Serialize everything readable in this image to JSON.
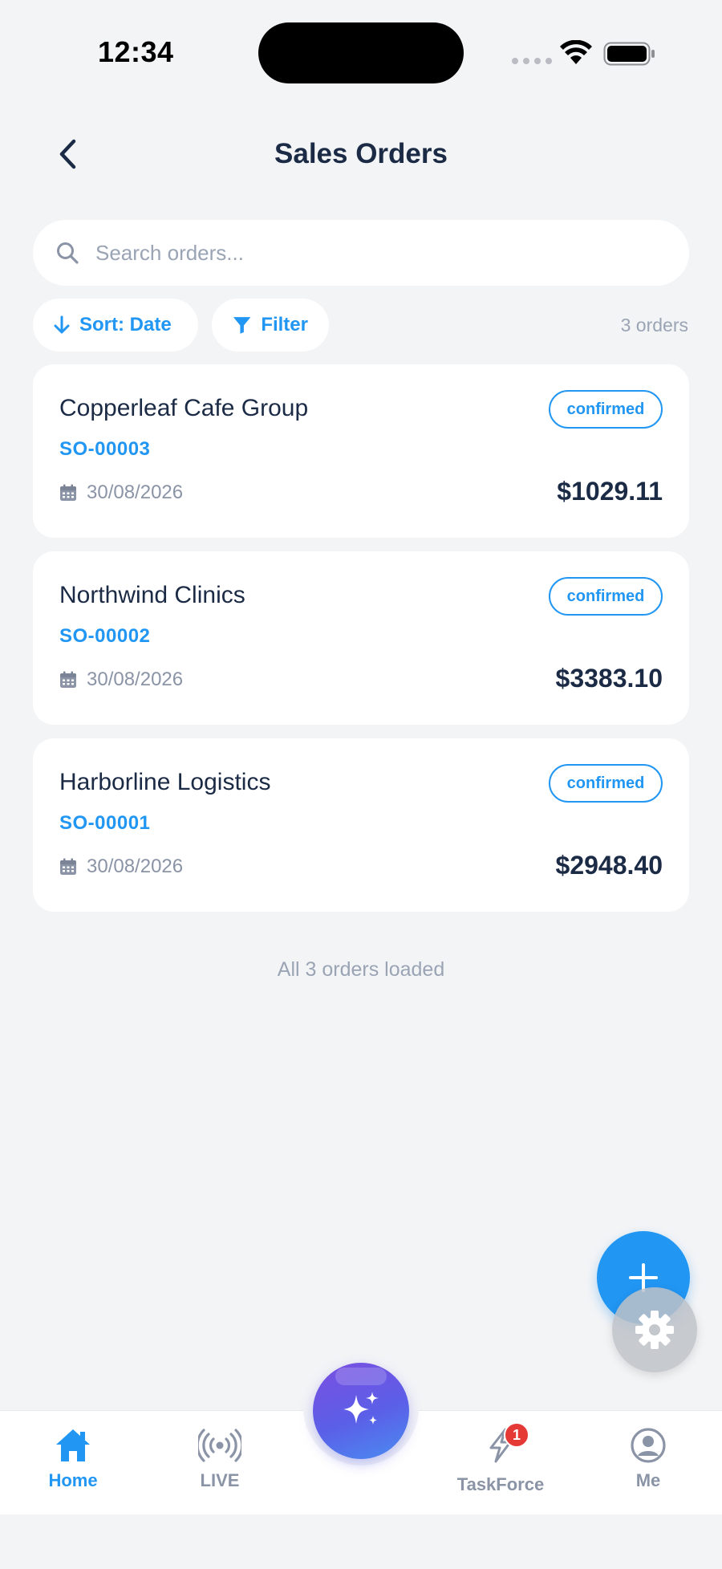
{
  "status_bar": {
    "time": "12:34"
  },
  "header": {
    "title": "Sales Orders"
  },
  "search": {
    "placeholder": "Search orders..."
  },
  "toolbar": {
    "sort_label": "Sort: Date",
    "filter_label": "Filter",
    "count_text": "3 orders"
  },
  "orders": [
    {
      "customer": "Copperleaf Cafe Group",
      "order_no": "SO-00003",
      "date": "30/08/2026",
      "status": "confirmed",
      "amount": "$1029.11"
    },
    {
      "customer": "Northwind Clinics",
      "order_no": "SO-00002",
      "date": "30/08/2026",
      "status": "confirmed",
      "amount": "$3383.10"
    },
    {
      "customer": "Harborline Logistics",
      "order_no": "SO-00001",
      "date": "30/08/2026",
      "status": "confirmed",
      "amount": "$2948.40"
    }
  ],
  "footer_note": "All 3 orders loaded",
  "tabbar": {
    "items": [
      {
        "label": "Home",
        "icon": "home-icon",
        "active": true
      },
      {
        "label": "LIVE",
        "icon": "broadcast-icon",
        "active": false
      },
      {
        "label": "TaskForce",
        "icon": "lightning-icon",
        "active": false,
        "badge": "1"
      },
      {
        "label": "Me",
        "icon": "user-circle-icon",
        "active": false
      }
    ],
    "center_icon": "sparkles-icon"
  },
  "colors": {
    "accent": "#2196F3",
    "text": "#1B2A45",
    "muted": "#9AA4B4",
    "badge": "#E53935",
    "background": "#F3F4F6"
  }
}
